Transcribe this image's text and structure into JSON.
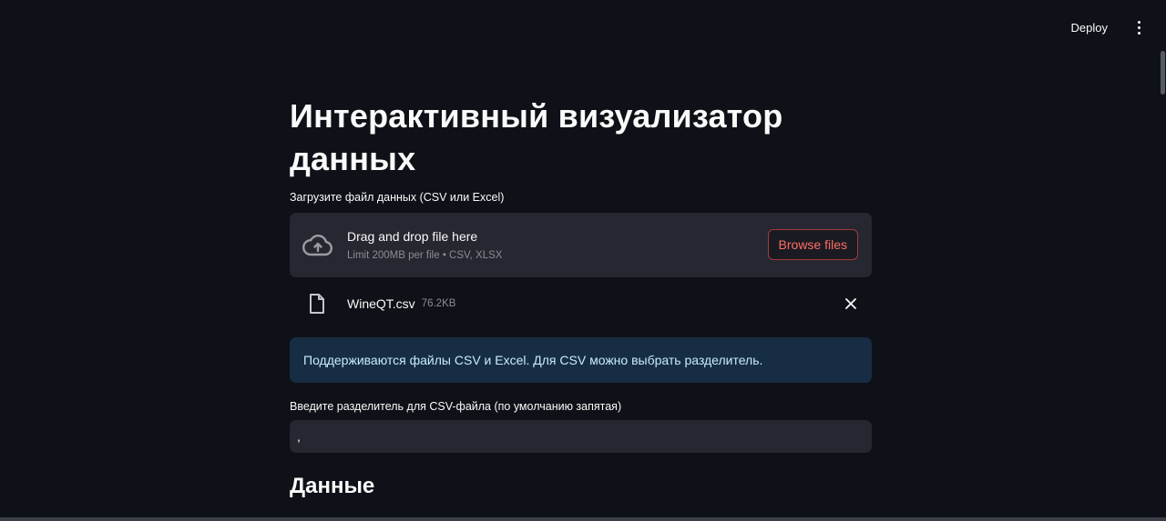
{
  "header": {
    "deploy_label": "Deploy"
  },
  "main": {
    "title": "Интерактивный визуализатор данных",
    "uploader": {
      "label": "Загрузите файл данных (CSV или Excel)",
      "drop_text": "Drag and drop file here",
      "limit_text": "Limit 200MB per file • CSV, XLSX",
      "browse_label": "Browse files"
    },
    "file": {
      "name": "WineQT.csv",
      "size": "76.2KB"
    },
    "info": "Поддерживаются файлы CSV и Excel. Для CSV можно выбрать разделитель.",
    "separator": {
      "label": "Введите разделитель для CSV-файла (по умолчанию запятая)",
      "value": ","
    },
    "data_section_title": "Данные"
  },
  "colors": {
    "background": "#0e1117",
    "surface": "#262730",
    "accent": "#ff4b4b",
    "info_bg": "#172d43",
    "info_text": "#c7ebff"
  }
}
